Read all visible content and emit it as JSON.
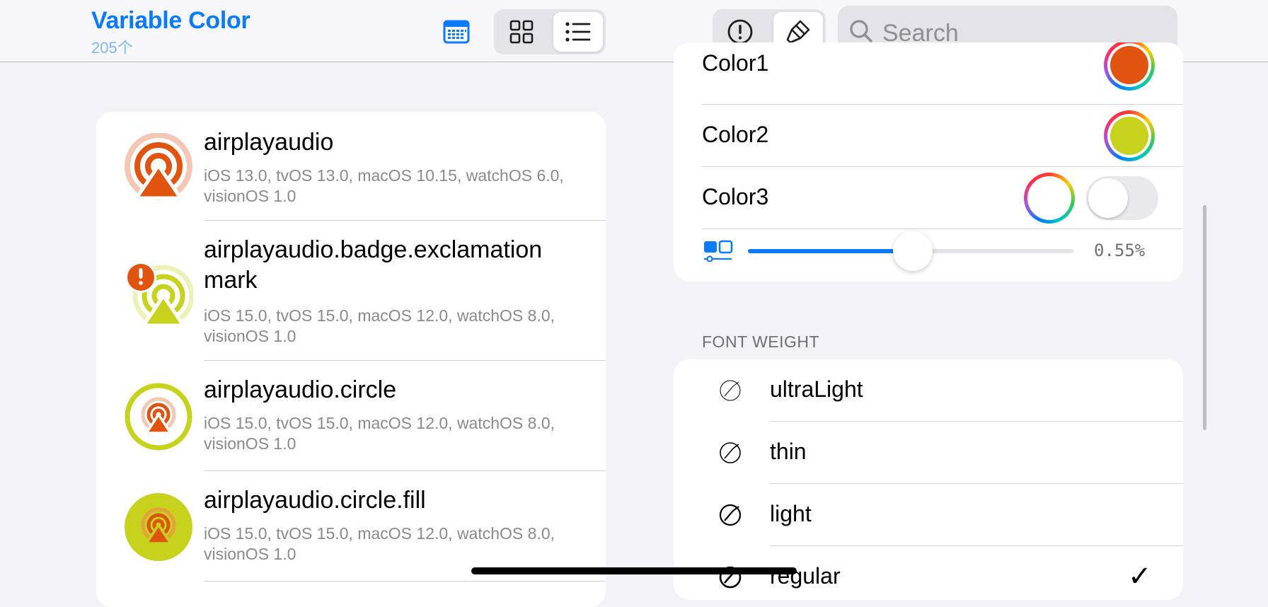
{
  "header": {
    "title": "Variable Color",
    "count": "205个",
    "view_buttons": [
      "calendar-icon",
      "grid-icon",
      "list-icon"
    ],
    "selected_view": "list",
    "tool_buttons": [
      "exclamation-icon",
      "paintbrush-icon"
    ],
    "search_placeholder": "Search",
    "accent": "#0a7aff"
  },
  "symbols": [
    {
      "name": "airplayaudio",
      "availability": "iOS 13.0, tvOS 13.0, macOS 10.15, watchOS 6.0, visionOS 1.0"
    },
    {
      "name": "airplayaudio.badge.exclamation mark",
      "availability": "iOS 15.0, tvOS 15.0, macOS 12.0, watchOS 8.0, visionOS 1.0"
    },
    {
      "name": "airplayaudio.circle",
      "availability": "iOS 15.0, tvOS 15.0, macOS 12.0, watchOS 8.0, visionOS 1.0"
    },
    {
      "name": "airplayaudio.circle.fill",
      "availability": "iOS 15.0, tvOS 15.0, macOS 12.0, watchOS 8.0, visionOS 1.0"
    }
  ],
  "colors": {
    "rows": [
      {
        "label": "Color1",
        "color": "#e0540f"
      },
      {
        "label": "Color2",
        "color": "#c6d21c"
      },
      {
        "label": "Color3",
        "color": "#ffffff",
        "enabled": false
      }
    ],
    "variable_value_fraction": 0.55,
    "variable_value_label": "0.55%"
  },
  "font_weight": {
    "header": "FONT WEIGHT",
    "options": [
      "ultraLight",
      "thin",
      "light",
      "regular"
    ],
    "selected": "regular"
  }
}
